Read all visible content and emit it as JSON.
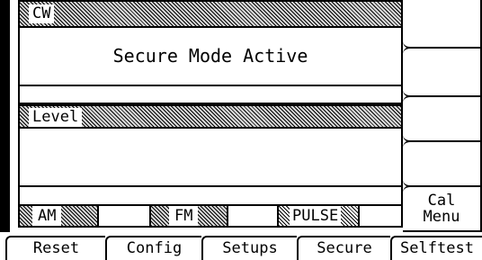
{
  "cw_panel": {
    "label": "CW",
    "message": "Secure Mode Active"
  },
  "level_panel": {
    "label": "Level"
  },
  "modulation": {
    "am": "AM",
    "fm": "FM",
    "pulse": "PULSE"
  },
  "softkeys": {
    "cal_menu_line1": "Cal",
    "cal_menu_line2": "Menu"
  },
  "bottom_menu": [
    "Reset",
    "Config",
    "Setups",
    "Secure",
    "Selftest"
  ],
  "colors": {
    "background": "#ffffff",
    "ink": "#000000",
    "hatch": "#d8d8d8"
  }
}
